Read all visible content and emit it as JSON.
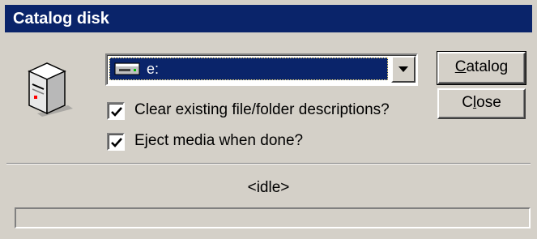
{
  "window": {
    "title": "Catalog disk"
  },
  "drive_select": {
    "selected": "e:",
    "icon": "drive-icon"
  },
  "options": {
    "clear_descriptions": {
      "label": "Clear existing file/folder descriptions?",
      "checked": true
    },
    "eject_media": {
      "label": "Eject media when done?",
      "checked": true
    }
  },
  "buttons": {
    "catalog": {
      "label": "Catalog",
      "mnemonic": "C"
    },
    "close": {
      "label": "Close",
      "mnemonic": "l"
    }
  },
  "status": {
    "text": "<idle>",
    "progress": 0
  },
  "colors": {
    "titlebar": "#0a246a",
    "face": "#d4d0c8",
    "selection": "#0a246a"
  }
}
